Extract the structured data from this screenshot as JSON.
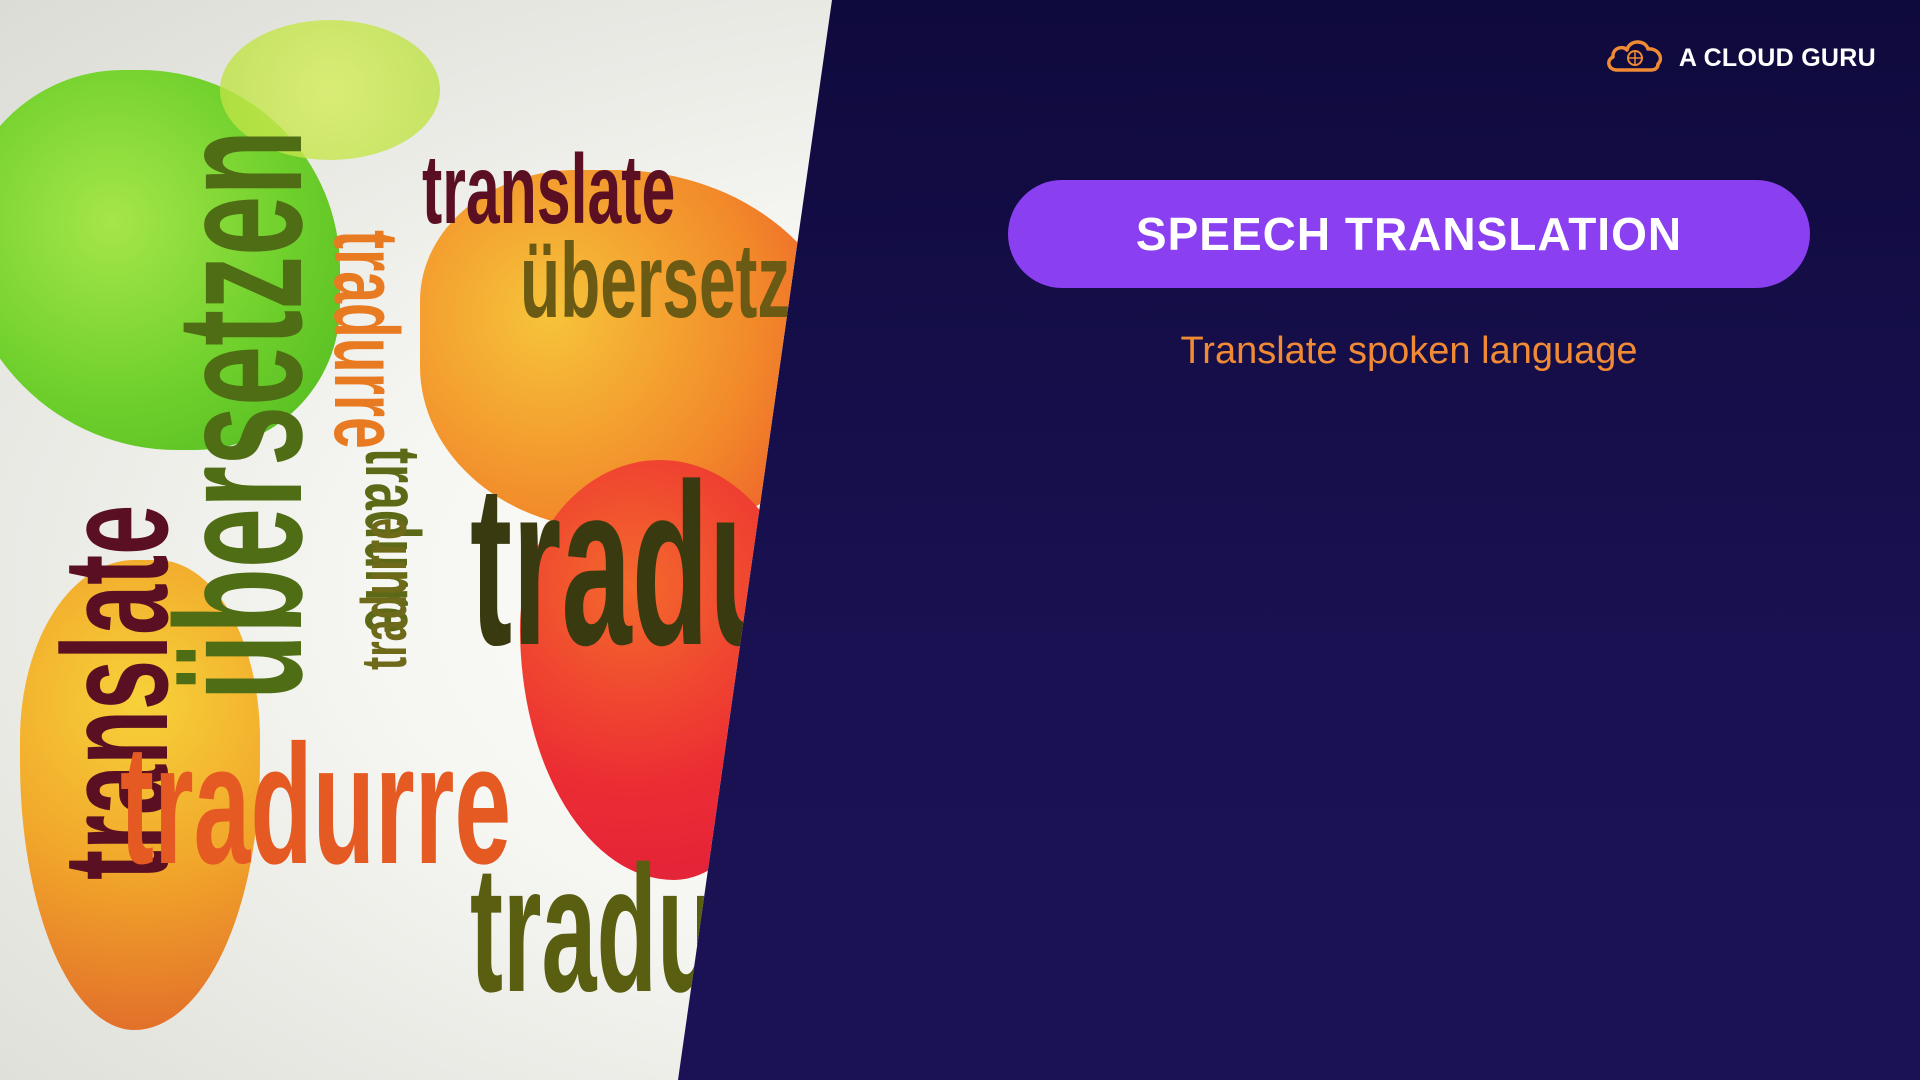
{
  "brand": {
    "name": "A CLOUD GURU",
    "logo_icon": "cloud-logo-icon"
  },
  "slide": {
    "title": "SPEECH TRANSLATION",
    "subtitle": "Translate spoken language"
  },
  "image_words": [
    "translate",
    "übersetzen",
    "translate",
    "übersetzen",
    "tradurre",
    "tradurre",
    "tradurre",
    "traduc",
    "tradurre",
    "tradui"
  ],
  "colors": {
    "background": "#140f4a",
    "pill": "#8a3ff0",
    "subtitle": "#f08a34",
    "brand_text": "#ffffff",
    "logo": "#f08a34"
  }
}
